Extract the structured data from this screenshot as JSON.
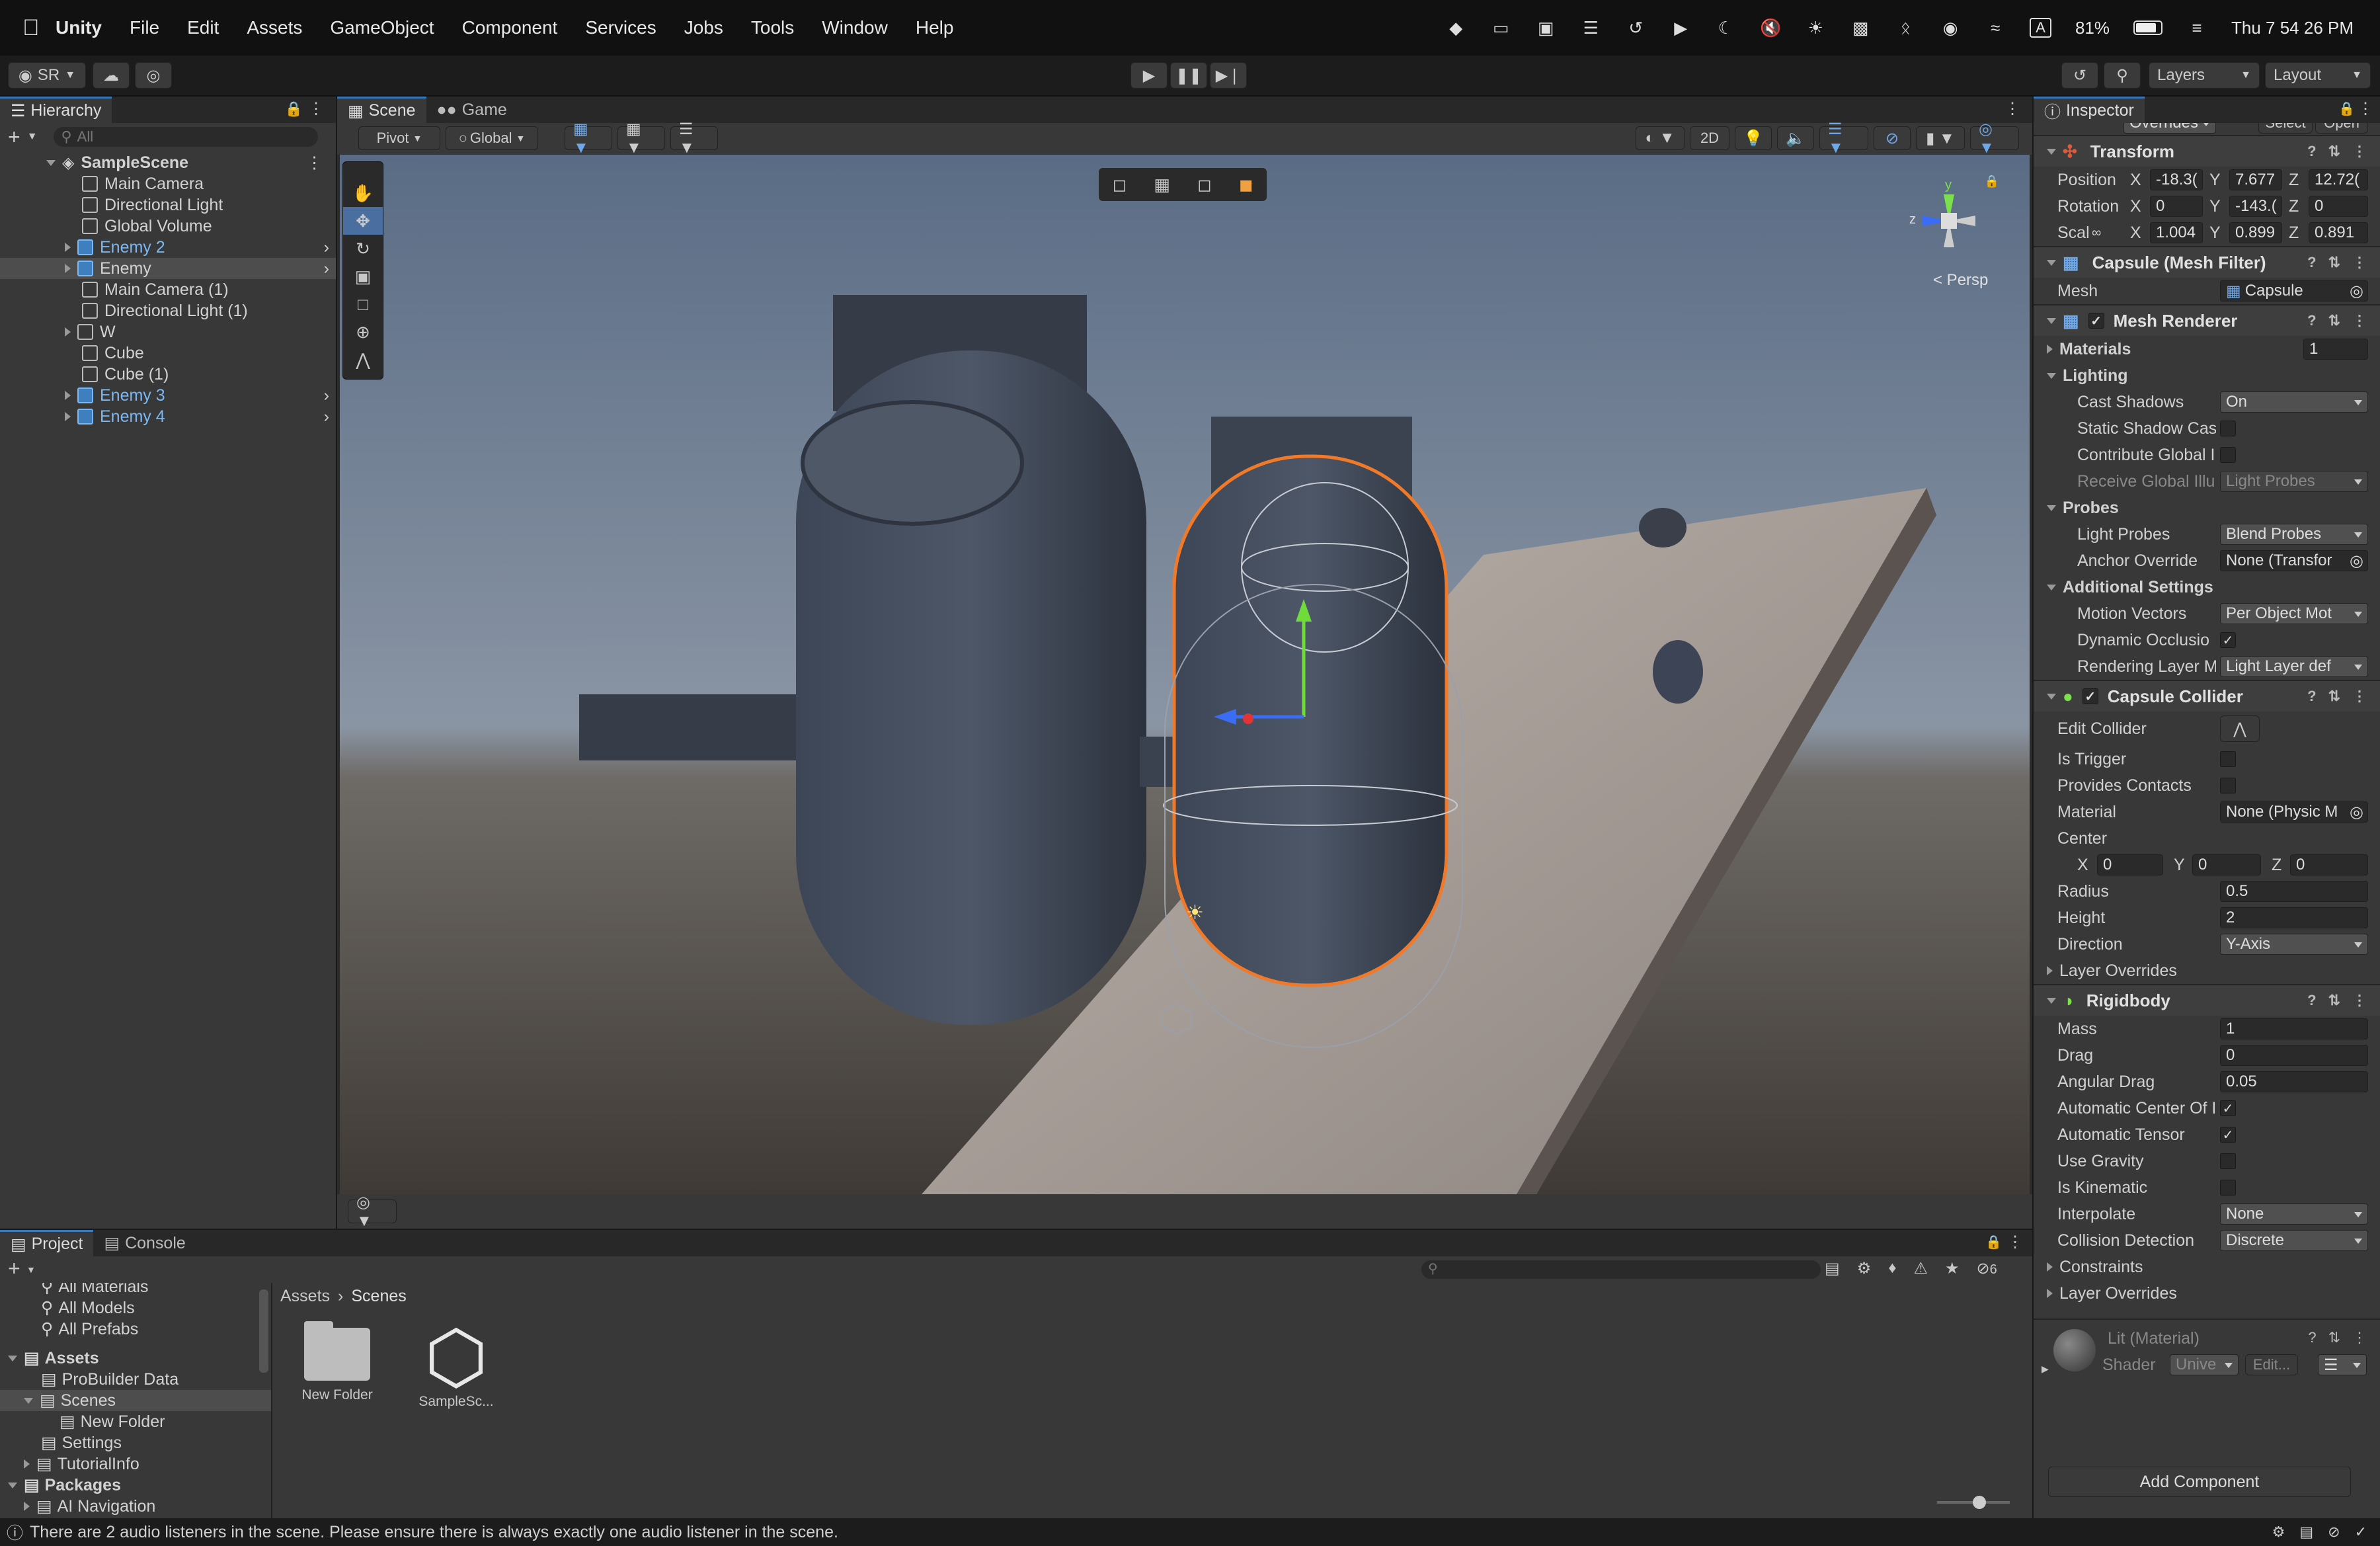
{
  "menubar": {
    "app": "Unity",
    "items": [
      "File",
      "Edit",
      "Assets",
      "GameObject",
      "Component",
      "Services",
      "Jobs",
      "Tools",
      "Window",
      "Help"
    ],
    "battery": "81%",
    "input": "A",
    "clock": "Thu 7 54 26 PM"
  },
  "toolbar": {
    "account": "SR",
    "layers": "Layers",
    "layout": "Layout"
  },
  "hierarchy": {
    "title": "Hierarchy",
    "search_placeholder": "All",
    "scene": "SampleScene",
    "items": [
      {
        "label": "Main Camera"
      },
      {
        "label": "Directional Light"
      },
      {
        "label": "Global Volume"
      },
      {
        "label": "Enemy 2"
      },
      {
        "label": "Enemy"
      },
      {
        "label": "Main Camera (1)"
      },
      {
        "label": "Directional Light (1)"
      },
      {
        "label": "W"
      },
      {
        "label": "Cube"
      },
      {
        "label": "Cube (1)"
      },
      {
        "label": "Enemy 3"
      },
      {
        "label": "Enemy 4"
      }
    ]
  },
  "scene_view": {
    "tab_scene": "Scene",
    "tab_game": "Game",
    "pivot": "Pivot",
    "global": "Global",
    "mode_2d": "2D",
    "persp": "< Persp"
  },
  "project": {
    "tab_project": "Project",
    "tab_console": "Console",
    "favorites": [
      "All Materials",
      "All Models",
      "All Prefabs"
    ],
    "tree_assets": "Assets",
    "tree": [
      "ProBuilder Data",
      "Scenes",
      "New Folder",
      "Settings",
      "TutorialInfo"
    ],
    "tree_packages": "Packages",
    "tree_packages_child": "AI Navigation",
    "breadcrumb_root": "Assets",
    "breadcrumb_current": "Scenes",
    "assets": [
      {
        "label": "New Folder"
      },
      {
        "label": "SampleSc..."
      }
    ],
    "hidden_count": "6"
  },
  "inspector": {
    "title": "Inspector",
    "overrides": "Overrides",
    "select": "Select",
    "open": "Open",
    "transform": {
      "title": "Transform",
      "position_label": "Position",
      "position": {
        "x": "-18.3(",
        "y": "7.677",
        "z": "12.72("
      },
      "rotation_label": "Rotation",
      "rotation": {
        "x": "0",
        "y": "-143.(",
        "z": "0"
      },
      "scale_label": "Scale",
      "scale": {
        "x": "1.004",
        "y": "0.899",
        "z": "0.891"
      }
    },
    "mesh_filter": {
      "title": "Capsule (Mesh Filter)",
      "mesh_label": "Mesh",
      "mesh": "Capsule"
    },
    "mesh_renderer": {
      "title": "Mesh Renderer",
      "materials_label": "Materials",
      "materials": "1",
      "lighting": "Lighting",
      "cast_shadows_label": "Cast Shadows",
      "cast_shadows": "On",
      "static_shadow": "Static Shadow Cas",
      "contribute_gi": "Contribute Global I",
      "receive_gi": "Receive Global Illu",
      "receive_gi_value": "Light Probes",
      "probes": "Probes",
      "light_probes_label": "Light Probes",
      "light_probes": "Blend Probes",
      "anchor_label": "Anchor Override",
      "anchor": "None (Transfor",
      "additional": "Additional Settings",
      "motion_label": "Motion Vectors",
      "motion": "Per Object Mot",
      "dynamic_occ": "Dynamic Occlusio",
      "rendering_layer_label": "Rendering Layer M",
      "rendering_layer": "Light Layer def"
    },
    "capsule_collider": {
      "title": "Capsule Collider",
      "edit_collider": "Edit Collider",
      "is_trigger": "Is Trigger",
      "provides_contacts": "Provides Contacts",
      "material_label": "Material",
      "material": "None (Physic M",
      "center_label": "Center",
      "center": {
        "x": "0",
        "y": "0",
        "z": "0"
      },
      "radius_label": "Radius",
      "radius": "0.5",
      "height_label": "Height",
      "height": "2",
      "direction_label": "Direction",
      "direction": "Y-Axis",
      "layer_overrides": "Layer Overrides"
    },
    "rigidbody": {
      "title": "Rigidbody",
      "mass_label": "Mass",
      "mass": "1",
      "drag_label": "Drag",
      "drag": "0",
      "angular_drag_label": "Angular Drag",
      "angular_drag": "0.05",
      "auto_center": "Automatic Center Of I",
      "auto_tensor": "Automatic Tensor",
      "use_gravity": "Use Gravity",
      "is_kinematic": "Is Kinematic",
      "interpolate_label": "Interpolate",
      "interpolate": "None",
      "collision_label": "Collision Detection",
      "collision": "Discrete",
      "constraints": "Constraints",
      "layer_overrides": "Layer Overrides"
    },
    "material": {
      "title": "Lit (Material)",
      "shader_label": "Shader",
      "shader": "Unive",
      "edit": "Edit..."
    },
    "add_component": "Add Component"
  },
  "status": {
    "message": "There are 2 audio listeners in the scene. Please ensure there is always exactly one audio listener in the scene."
  }
}
